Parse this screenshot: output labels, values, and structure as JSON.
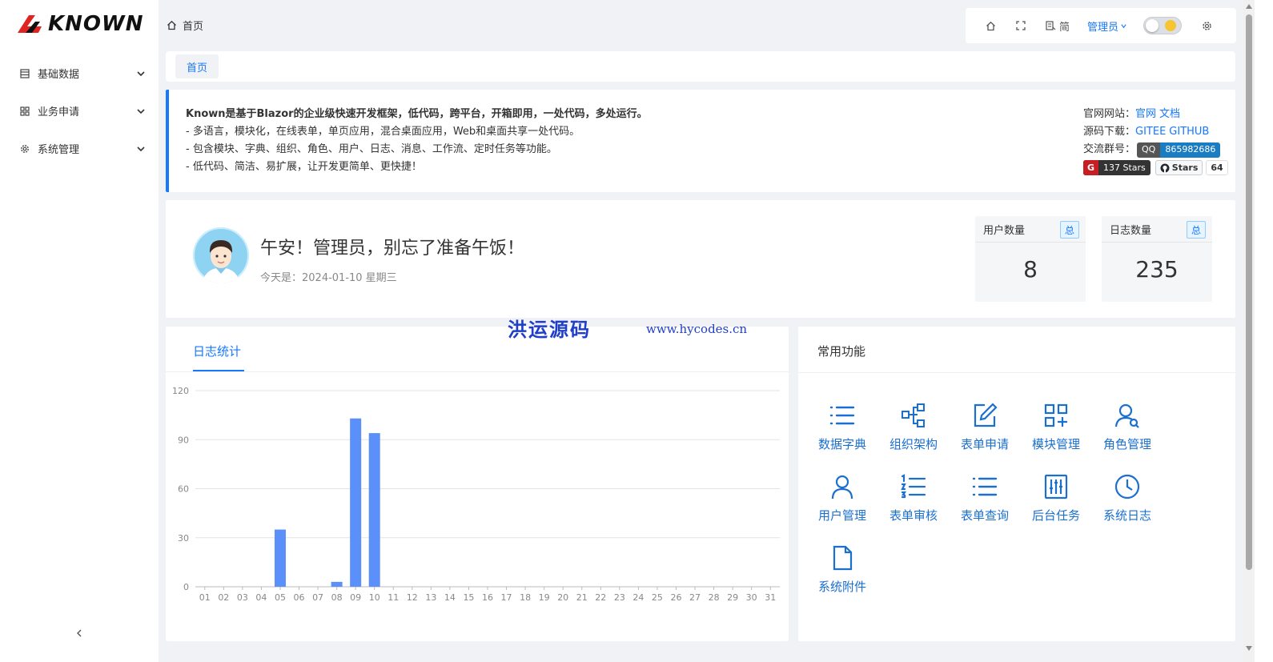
{
  "logo": {
    "text": "KNOWN"
  },
  "sidebar": {
    "items": [
      {
        "label": "基础数据",
        "icon": "table-icon"
      },
      {
        "label": "业务申请",
        "icon": "grid-icon"
      },
      {
        "label": "系统管理",
        "icon": "gear-icon"
      }
    ]
  },
  "breadcrumb": {
    "label": "首页"
  },
  "toolbar": {
    "lang_label": "简",
    "user_label": "管理员"
  },
  "tabs": [
    {
      "label": "首页"
    }
  ],
  "intro": {
    "lines": [
      "Known是基于Blazor的企业级快速开发框架，低代码，跨平台，开箱即用，一处代码，多处运行。",
      "- 多语言，模块化，在线表单，单页应用，混合桌面应用，Web和桌面共享一处代码。",
      "- 包含模块、字典、组织、角色、用户、日志、消息、工作流、定时任务等功能。",
      "- 低代码、简洁、易扩展，让开发更简单、更快捷！"
    ],
    "site_label": "官网网站：",
    "site_links": [
      "官网",
      "文档"
    ],
    "download_label": "源码下载：",
    "download_links": [
      "GITEE",
      "GITHUB"
    ],
    "group_label": "交流群号：",
    "qq_key": "QQ",
    "qq_value": "865982686",
    "gitee_stars": "137 Stars",
    "github_label": "Stars",
    "github_count": "64"
  },
  "welcome": {
    "greeting": "午安！管理员，别忘了准备午饭！",
    "today": "今天是：2024-01-10 星期三"
  },
  "stats": [
    {
      "title": "用户数量",
      "tag": "总",
      "value": "8"
    },
    {
      "title": "日志数量",
      "tag": "总",
      "value": "235"
    }
  ],
  "watermark": {
    "cn": "洪运源码",
    "url": "www.hycodes.cn"
  },
  "chart_card": {
    "tab_label": "日志统计"
  },
  "chart_data": {
    "type": "bar",
    "categories": [
      "01",
      "02",
      "03",
      "04",
      "05",
      "06",
      "07",
      "08",
      "09",
      "10",
      "11",
      "12",
      "13",
      "14",
      "15",
      "16",
      "17",
      "18",
      "19",
      "20",
      "21",
      "22",
      "23",
      "24",
      "25",
      "26",
      "27",
      "28",
      "29",
      "30",
      "31"
    ],
    "values": [
      0,
      0,
      0,
      0,
      35,
      0,
      0,
      3,
      103,
      94,
      0,
      0,
      0,
      0,
      0,
      0,
      0,
      0,
      0,
      0,
      0,
      0,
      0,
      0,
      0,
      0,
      0,
      0,
      0,
      0,
      0
    ],
    "yticks": [
      "0",
      "30",
      "60",
      "90",
      "120"
    ],
    "ylim": [
      0,
      120
    ],
    "grid": true,
    "color": "#5b8ff9"
  },
  "functions": {
    "title": "常用功能",
    "items": [
      {
        "label": "数据字典",
        "icon": "list-icon"
      },
      {
        "label": "组织架构",
        "icon": "org-chart-icon"
      },
      {
        "label": "表单申请",
        "icon": "edit-icon"
      },
      {
        "label": "模块管理",
        "icon": "modules-icon"
      },
      {
        "label": "角色管理",
        "icon": "role-icon"
      },
      {
        "label": "用户管理",
        "icon": "user-icon"
      },
      {
        "label": "表单审核",
        "icon": "ordered-list-icon"
      },
      {
        "label": "表单查询",
        "icon": "list-query-icon"
      },
      {
        "label": "后台任务",
        "icon": "sliders-icon"
      },
      {
        "label": "系统日志",
        "icon": "clock-icon"
      },
      {
        "label": "系统附件",
        "icon": "file-icon"
      }
    ]
  },
  "colors": {
    "accent": "#1677ff",
    "bar": "#5b8ff9",
    "function_blue": "#1b6fcf"
  }
}
